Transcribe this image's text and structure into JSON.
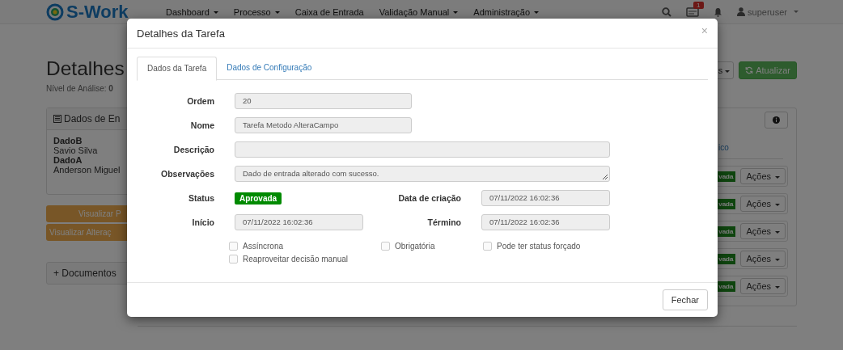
{
  "navbar": {
    "logo": "S-Work",
    "menu": [
      {
        "label": "Dashboard",
        "dropdown": true
      },
      {
        "label": "Processo",
        "dropdown": true
      },
      {
        "label": "Caixa de Entrada",
        "dropdown": false
      },
      {
        "label": "Validação Manual",
        "dropdown": true
      },
      {
        "label": "Administração",
        "dropdown": true
      }
    ],
    "inbox_badge": "1",
    "user": "superuser"
  },
  "page": {
    "title": "Detalhes",
    "level_label": "Nível de Análise:",
    "level_value": "0",
    "toolbar": {
      "menu_button": "s",
      "refresh_button": "Atualizar"
    },
    "data_panel": {
      "title": "Dados de En",
      "items": [
        {
          "name": "DadoB",
          "value": "Savio Silva"
        },
        {
          "name": "DadoA",
          "value": "Anderson Miguel"
        }
      ]
    },
    "buttons": [
      "Visualizar P",
      "Visualizar Alteraç"
    ],
    "documents_panel": "+ Documentos",
    "history_panel": {
      "link": "ico",
      "rows": [
        {
          "status": "vada",
          "action": "Ações"
        },
        {
          "status": "vada",
          "action": "Ações"
        },
        {
          "status": "vada",
          "action": "Ações"
        },
        {
          "status": "vada",
          "action": "Ações"
        },
        {
          "status": "vada",
          "action": "Ações"
        }
      ]
    }
  },
  "modal": {
    "title": "Detalhes da Tarefa",
    "close": "×",
    "tabs": [
      {
        "label": "Dados da Tarefa",
        "selected": true
      },
      {
        "label": "Dados de Configuração",
        "selected": false
      }
    ],
    "rows": [
      [
        {
          "label": "Ordem",
          "kind": "short",
          "value": "20"
        }
      ],
      [
        {
          "label": "Nome",
          "kind": "short",
          "value": "Tarefa Metodo AlteraCampo"
        }
      ],
      [
        {
          "label": "Descrição",
          "kind": "wide"
        }
      ],
      [
        {
          "label": "Observações",
          "kind": "textarea",
          "value": "Dado de entrada alterado com sucesso."
        }
      ],
      [
        {
          "label": "Status",
          "kind": "badge",
          "value": "Aprovada"
        },
        {
          "label": "Data de criação",
          "kind": "half",
          "value": "07/11/2022 16:02:36"
        }
      ],
      [
        {
          "label": "Início",
          "kind": "half",
          "value": "07/11/2022 16:02:36"
        },
        {
          "label": "Término",
          "kind": "half",
          "value": "07/11/2022 16:02:36"
        }
      ]
    ],
    "checkboxes": [
      {
        "label": "Assíncrona",
        "checked": false
      },
      {
        "label": "Obrigatória",
        "checked": false
      },
      {
        "label": "Pode ter status forçado",
        "checked": false
      },
      {
        "label": "Reaproveitar decisão manual",
        "checked": false
      }
    ],
    "footer_button": "Fechar"
  }
}
